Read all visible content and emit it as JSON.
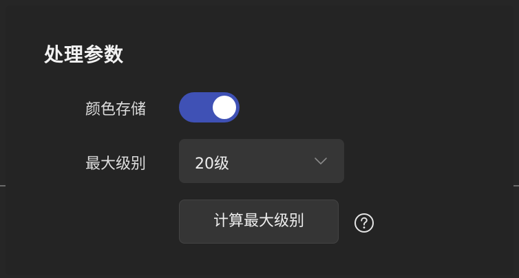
{
  "panel": {
    "title": "处理参数"
  },
  "color_storage": {
    "label": "颜色存储",
    "enabled": true,
    "accent": "#3f51b5"
  },
  "max_level": {
    "label": "最大级别",
    "selected": "20级",
    "icon": "chevron-down-icon"
  },
  "compute_button": {
    "label": "计算最大级别"
  },
  "help": {
    "icon": "help-circle-icon"
  }
}
